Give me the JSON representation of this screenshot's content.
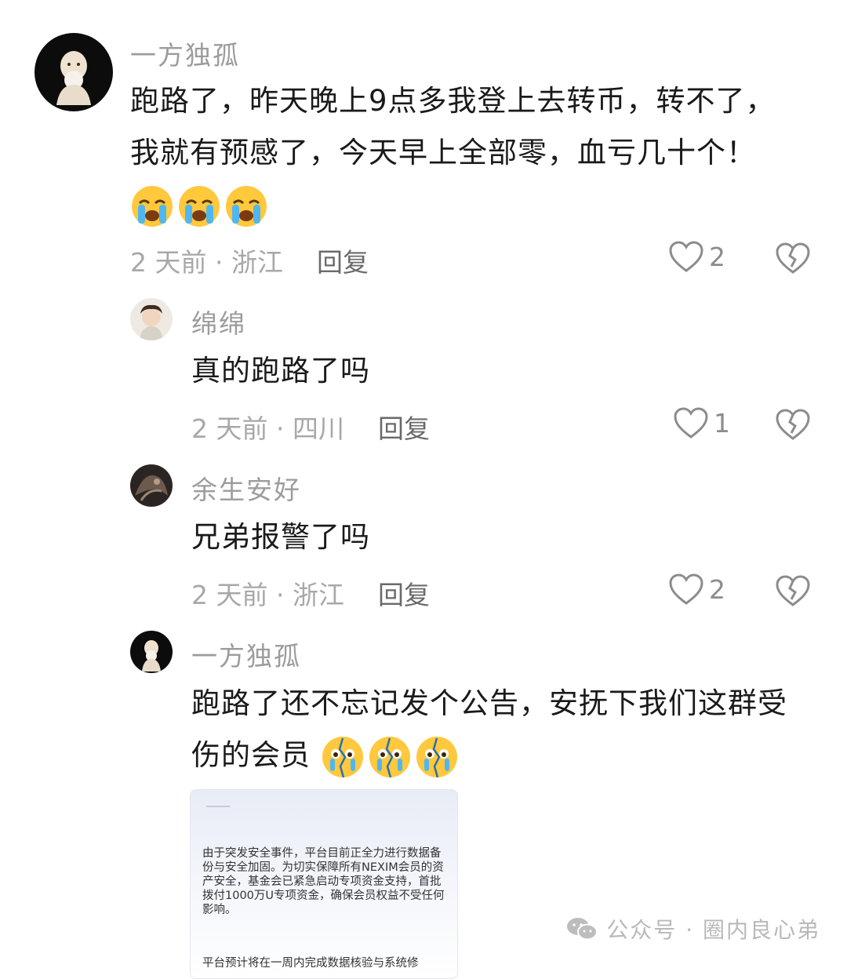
{
  "comments": [
    {
      "username": "一方独孤",
      "text": "跑路了，昨天晚上9点多我登上去转币，转不了，我就有预感了，今天早上全部零，血亏几十个！",
      "emoji_icons": [
        "loudly-crying-emoji",
        "loudly-crying-emoji",
        "loudly-crying-emoji"
      ],
      "meta": "2 天前 · 浙江",
      "reply_label": "回复",
      "likes": "2"
    },
    {
      "username": "绵绵",
      "text": "真的跑路了吗",
      "meta": "2 天前 · 四川",
      "reply_label": "回复",
      "likes": "1"
    },
    {
      "username": "余生安好",
      "text": "兄弟报警了吗",
      "meta": "2 天前 · 浙江",
      "reply_label": "回复",
      "likes": "2"
    },
    {
      "username": "一方独孤",
      "text": "跑路了还不忘记发个公告，安抚下我们这群受伤的会员",
      "emoji_icons": [
        "broken-face-emoji",
        "broken-face-emoji",
        "broken-face-emoji"
      ],
      "attachment": {
        "body": "由于突发安全事件，平台目前正全力进行数据备份与安全加固。为切实保障所有NEXIM会员的资产安全，基金会已紧急启动专项资金支持，首批拨付1000万U专项资金，确保会员权益不受任何影响。",
        "body_cutoff": "平台预计将在一周内完成数据核验与系统修"
      }
    }
  ],
  "icons": {
    "like": "heart-outline-icon",
    "dislike": "broken-heart-icon"
  },
  "watermark": {
    "icon": "wechat-icon",
    "text": "公众号 · 圈内良心弟"
  }
}
